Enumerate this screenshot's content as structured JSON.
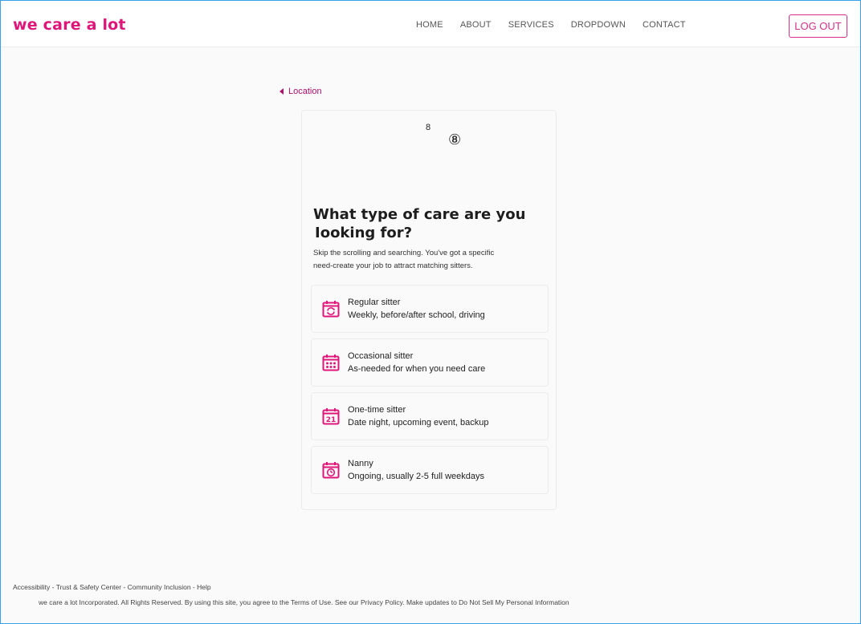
{
  "brand": {
    "logo_text": "we care a lot",
    "accent": "#e0157a"
  },
  "nav": {
    "items": [
      "HOME",
      "ABOUT",
      "SERVICES",
      "DROPDOWN",
      "CONTACT"
    ],
    "logout_label": "LOG OUT"
  },
  "back": {
    "label": "Location",
    "icon": "caret-left-icon"
  },
  "step": {
    "number": "8",
    "circle": "⑧"
  },
  "question": {
    "title_line1": "What type of care are you",
    "title_line2": "Iooking for?",
    "subtitle_line1": "Skip the scrolling and searching. You've got a specific",
    "subtitle_line2": "need-create your job to attract matching sitters."
  },
  "options": [
    {
      "title": "Regular sitter",
      "desc": "Weekly, before/after school, driving",
      "icon": "calendar-repeat-icon"
    },
    {
      "title": "Occasional sitter",
      "desc": "As-needed for when you need care",
      "icon": "calendar-dots-icon"
    },
    {
      "title": "One-time sitter",
      "desc": "Date night, upcoming event, backup",
      "icon": "calendar-21-icon",
      "icon_text": "21"
    },
    {
      "title": "Nanny",
      "desc": "Ongoing, usually 2-5 full weekdays",
      "icon": "calendar-clock-icon"
    }
  ],
  "footer": {
    "links": "Accessibility - Trust & Safety Center - Community Inclusion - Help",
    "copyright": "we care a lot  Incorporated. All Rights Reserved. By using this site, you agree to the Terms of Use. See our Privacy Policy. Make updates to Do Not Sell My Personal Information"
  }
}
